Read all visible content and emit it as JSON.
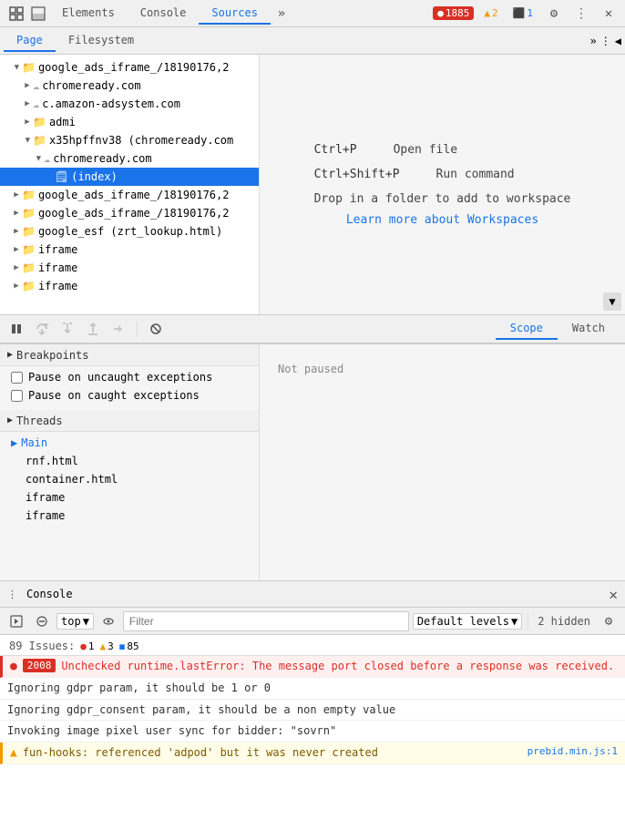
{
  "topbar": {
    "tabs": [
      {
        "id": "elements",
        "label": "Elements",
        "active": false
      },
      {
        "id": "console",
        "label": "Console",
        "active": false
      },
      {
        "id": "sources",
        "label": "Sources",
        "active": true
      }
    ],
    "more_icon": "»",
    "errors": {
      "icon": "●",
      "count": "1885"
    },
    "warnings": {
      "icon": "▲",
      "count": "2"
    },
    "infos": {
      "icon": "⬛",
      "count": "1"
    },
    "settings_icon": "⚙",
    "more_icon2": "⋮",
    "close_icon": "✕"
  },
  "subtabs": {
    "tabs": [
      {
        "id": "page",
        "label": "Page",
        "active": true
      },
      {
        "id": "filesystem",
        "label": "Filesystem",
        "active": false
      }
    ],
    "more_icon": "»",
    "options_icon": "⋮",
    "collapse_icon": "◀"
  },
  "filetree": {
    "items": [
      {
        "id": "root",
        "label": "google_ads_iframe_/18190176,2",
        "type": "folder-expanded",
        "level": 0,
        "selected": false
      },
      {
        "id": "chromeready1",
        "label": "chromeready.com",
        "type": "cloud",
        "level": 1,
        "selected": false
      },
      {
        "id": "amazon",
        "label": "c.amazon-adsystem.com",
        "type": "cloud",
        "level": 1,
        "selected": false
      },
      {
        "id": "admi",
        "label": "admi",
        "type": "folder",
        "level": 1,
        "selected": false
      },
      {
        "id": "x35h",
        "label": "x35hpffnv38 (chromeready.com",
        "type": "folder-expanded",
        "level": 1,
        "selected": false
      },
      {
        "id": "chromeready2",
        "label": "chromeready.com",
        "type": "cloud-expanded",
        "level": 2,
        "selected": false
      },
      {
        "id": "index",
        "label": "(index)",
        "type": "file",
        "level": 3,
        "selected": true
      },
      {
        "id": "googleads1",
        "label": "google_ads_iframe_/18190176,2",
        "type": "folder",
        "level": 0,
        "selected": false
      },
      {
        "id": "googleads2",
        "label": "google_ads_iframe_/18190176,2",
        "type": "folder",
        "level": 0,
        "selected": false
      },
      {
        "id": "googleesf",
        "label": "google_esf (zrt_lookup.html)",
        "type": "folder",
        "level": 0,
        "selected": false
      },
      {
        "id": "iframe1",
        "label": "iframe",
        "type": "folder",
        "level": 0,
        "selected": false
      },
      {
        "id": "iframe2",
        "label": "iframe",
        "type": "folder",
        "level": 0,
        "selected": false
      },
      {
        "id": "iframe3",
        "label": "iframe",
        "type": "folder",
        "level": 0,
        "selected": false
      }
    ]
  },
  "workspace": {
    "shortcut1_key": "Ctrl+P",
    "shortcut1_desc": "Open file",
    "shortcut2_key": "Ctrl+Shift+P",
    "shortcut2_desc": "Run command",
    "drop_text": "Drop in a folder to add to workspace",
    "learn_link": "Learn more about Workspaces"
  },
  "debug_toolbar": {
    "pause_label": "⏸",
    "step_over_label": "↻",
    "step_into_label": "↓",
    "step_out_label": "↑",
    "step_label": "→",
    "deactivate_label": "⁻"
  },
  "scope_tabs": [
    {
      "id": "scope",
      "label": "Scope",
      "active": true
    },
    {
      "id": "watch",
      "label": "Watch",
      "active": false
    }
  ],
  "not_paused_text": "Not paused",
  "breakpoints": {
    "title": "Breakpoints",
    "items": [
      {
        "label": "Pause on uncaught exceptions",
        "checked": false
      },
      {
        "label": "Pause on caught exceptions",
        "checked": false
      }
    ]
  },
  "threads": {
    "title": "Threads",
    "main": "Main",
    "items": [
      "rnf.html",
      "container.html",
      "iframe",
      "iframe"
    ]
  },
  "console_panel": {
    "title": "Console",
    "close_icon": "✕",
    "execute_icon": "▶",
    "block_icon": "⊘",
    "top_label": "top",
    "top_arrow": "▼",
    "eye_icon": "👁",
    "filter_placeholder": "Filter",
    "level_label": "Default levels",
    "level_arrow": "▼",
    "hidden_count": "2 hidden",
    "gear_icon": "⚙"
  },
  "issues": {
    "label": "89 Issues:",
    "errors": {
      "icon": "●",
      "count": "1"
    },
    "warnings": {
      "icon": "▲",
      "count": "3"
    },
    "infos": {
      "icon": "◼",
      "count": "85"
    }
  },
  "console_entries": [
    {
      "id": "entry1",
      "type": "error",
      "icon": "●",
      "number": "2008",
      "text": "Unchecked runtime.lastError: The message port closed before a response was received.",
      "source": null
    },
    {
      "id": "entry2",
      "type": "normal",
      "text": "Ignoring gdpr param, it should be 1 or 0",
      "source": null
    },
    {
      "id": "entry3",
      "type": "normal",
      "text": "Ignoring gdpr_consent param, it should be a non empty value",
      "source": null
    },
    {
      "id": "entry4",
      "type": "normal",
      "text": "Invoking image pixel user sync for bidder: \"sovrn\"",
      "source": null
    },
    {
      "id": "entry5",
      "type": "warn",
      "icon": "▲",
      "text": "fun-hooks: referenced 'adpod' but it was never created",
      "source": "prebid.min.js:1"
    }
  ]
}
